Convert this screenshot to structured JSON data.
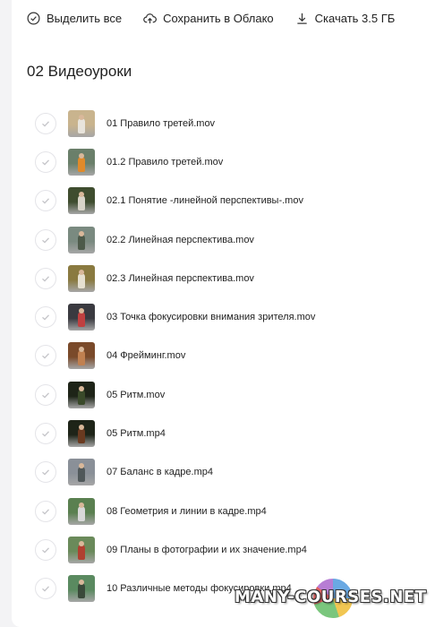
{
  "toolbar": {
    "select_all": "Выделить все",
    "save_cloud": "Сохранить в Облако",
    "download": "Скачать 3.5 ГБ"
  },
  "folder": {
    "title": "02 Видеоуроки"
  },
  "files": [
    {
      "name": "01 Правило третей.mov",
      "thumb_bg": "#c9b48e",
      "thumb_fg": "#e8e4dc"
    },
    {
      "name": "01.2 Правило третей.mov",
      "thumb_bg": "#6a7f6a",
      "thumb_fg": "#e08a2a"
    },
    {
      "name": "02.1 Понятие -линейной перспективы-.mov",
      "thumb_bg": "#3f4d2f",
      "thumb_fg": "#d8d4c8"
    },
    {
      "name": "02.2 Линейная перспектива.mov",
      "thumb_bg": "#7a8a80",
      "thumb_fg": "#4d5a4a"
    },
    {
      "name": "02.3 Линейная перспектива.mov",
      "thumb_bg": "#8a7a40",
      "thumb_fg": "#e6e0d0"
    },
    {
      "name": "03 Точка фокусировки внимания зрителя.mov",
      "thumb_bg": "#3a3a40",
      "thumb_fg": "#c04040"
    },
    {
      "name": "04 Фрейминг.mov",
      "thumb_bg": "#7a4a2a",
      "thumb_fg": "#c08050"
    },
    {
      "name": "05 Ритм.mov",
      "thumb_bg": "#1e2418",
      "thumb_fg": "#3a4a2a"
    },
    {
      "name": "05 Ритм.mp4",
      "thumb_bg": "#1e2418",
      "thumb_fg": "#6a3a20"
    },
    {
      "name": "07 Баланс в кадре.mp4",
      "thumb_bg": "#8a9098",
      "thumb_fg": "#50585a"
    },
    {
      "name": "08 Геометрия и линии в кадре.mp4",
      "thumb_bg": "#5a8050",
      "thumb_fg": "#d8d8d8"
    },
    {
      "name": "09 Планы в фотографии и их значение.mp4",
      "thumb_bg": "#6a8a5a",
      "thumb_fg": "#b04030"
    },
    {
      "name": "10 Различные методы фокусировки.mp4",
      "thumb_bg": "#5a8a60",
      "thumb_fg": "#3a4a3a"
    }
  ],
  "watermark": {
    "text": "MANY-COURSES.NET"
  }
}
